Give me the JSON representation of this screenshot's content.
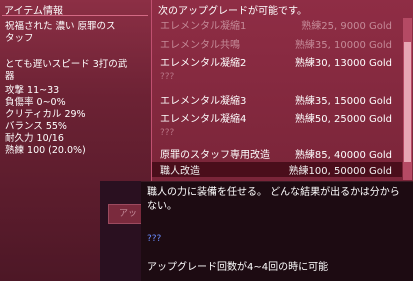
{
  "left_panel": {
    "title": "アイテム情報",
    "lines": [
      "祝福された 濃い 原罪のス",
      "タッフ",
      "とても遅いスピード 3打の武",
      "器",
      "攻撃 11~33",
      "負傷率 0~0%",
      "クリティカル 29%",
      "バランス 55%",
      "耐久力 10/16",
      "熟練 100 (20.0%)"
    ]
  },
  "right_panel": {
    "title": "次のアップグレードが可能です。",
    "rows": [
      {
        "name": "エレメンタル凝縮1",
        "cost": "熟練25, 9000 Gold",
        "state": "dim"
      },
      {
        "name": "エレメンタル共鳴",
        "cost": "熟練35, 10000 Gold",
        "state": "dim"
      },
      {
        "name": "エレメンタル凝縮2",
        "cost": "熟練30, 13000 Gold",
        "state": "active"
      },
      {
        "name": "???",
        "cost": "",
        "state": "unknown"
      },
      {
        "name": "エレメンタル凝縮3",
        "cost": "熟練35, 15000 Gold",
        "state": "active"
      },
      {
        "name": "エレメンタル凝縮4",
        "cost": "熟練50, 25000 Gold",
        "state": "active"
      },
      {
        "name": "???",
        "cost": "",
        "state": "unknown"
      },
      {
        "name": "原罪のスタッフ専用改造",
        "cost": "熟練85, 40000 Gold",
        "state": "active"
      },
      {
        "name": "職人改造",
        "cost": "熟練100, 50000 Gold",
        "state": "selected"
      }
    ]
  },
  "ghost_button": "アッ",
  "tooltip": {
    "text": "職人の力に装備を任せる。 どんな結果が出るかは分からない。",
    "question": "???",
    "condition": "アップグレード回数が4~4回の時に可能"
  }
}
